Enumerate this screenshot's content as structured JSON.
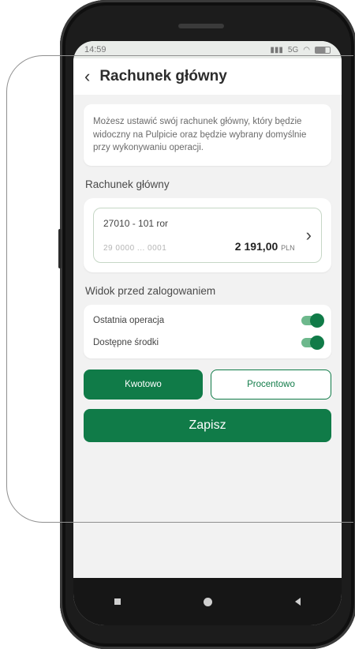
{
  "status": {
    "time": "14:59",
    "signal": "5G"
  },
  "header": {
    "title": "Rachunek główny",
    "back_icon": "chevron-left-icon"
  },
  "info": {
    "text": "Możesz ustawić swój rachunek główny, który będzie widoczny na Pulpicie oraz będzie wybrany domyślnie przy wykonywaniu operacji."
  },
  "main_account": {
    "section_label": "Rachunek główny",
    "name": "27010 - 101 ror",
    "number": "29 0000 ... 0001",
    "balance": "2 191,00",
    "currency": "PLN"
  },
  "login_view": {
    "section_label": "Widok przed zalogowaniem",
    "options": [
      {
        "label": "Ostatnia operacja",
        "enabled": true
      },
      {
        "label": "Dostępne środki",
        "enabled": true
      }
    ]
  },
  "mode": {
    "amount_label": "Kwotowo",
    "percent_label": "Procentowo",
    "selected": "Kwotowo"
  },
  "actions": {
    "save_label": "Zapisz"
  },
  "colors": {
    "brand": "#107b48",
    "background": "#f2f2f2"
  }
}
